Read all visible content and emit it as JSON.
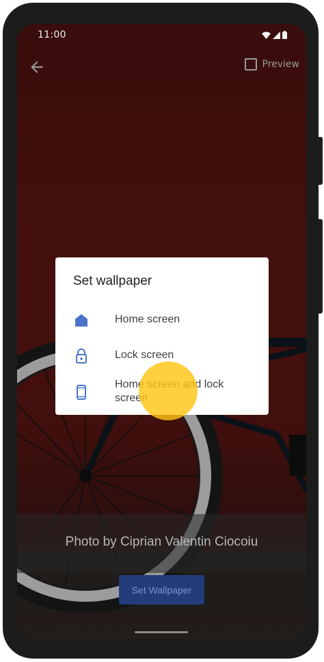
{
  "status_bar": {
    "time": "11:00",
    "icons": [
      "wifi-icon",
      "cell-signal-icon",
      "battery-icon"
    ]
  },
  "top_bar": {
    "back_icon": "arrow-back-icon",
    "preview_label": "Preview",
    "preview_checked": false
  },
  "dialog": {
    "title": "Set wallpaper",
    "options": [
      {
        "label": "Home screen",
        "icon": "home-icon"
      },
      {
        "label": "Lock screen",
        "icon": "lock-icon"
      },
      {
        "label": "Home screen and lock screen",
        "icon": "phone-icon"
      }
    ]
  },
  "credit": "Photo by Ciprian Valentin Ciocoiu",
  "set_button_label": "Set Wallpaper",
  "colors": {
    "accent_blue": "#4a74c9",
    "button_bg": "#223d7a",
    "wallpaper_red": "#5e1713",
    "touch_indicator": "#ffc414"
  }
}
